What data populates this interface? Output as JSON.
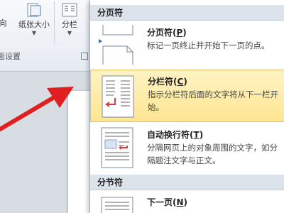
{
  "ribbon": {
    "direction_label": "向",
    "paper_size_label": "纸张大小",
    "breaks_label": "分栏",
    "group_label": "面设置"
  },
  "menu": {
    "section_breaks_header": "分页符",
    "section_section_header": "分节符",
    "items": [
      {
        "title": "分页符",
        "key": "P",
        "desc": "标记一页终止并开始下一页的点。",
        "icon": "page-break-icon"
      },
      {
        "title": "分栏符",
        "key": "C",
        "desc": "指示分栏符后面的文字将从下一栏开始。",
        "icon": "column-break-icon"
      },
      {
        "title": "自动换行符",
        "key": "T",
        "desc": "分隔网页上的对象周围的文字，如分隔题注文字与正文。",
        "icon": "text-wrapping-break-icon"
      },
      {
        "title": "下一页",
        "key": "N",
        "desc": "",
        "icon": "next-page-icon"
      }
    ]
  },
  "colors": {
    "highlight": "#fde591",
    "arrow": "#e02020"
  }
}
